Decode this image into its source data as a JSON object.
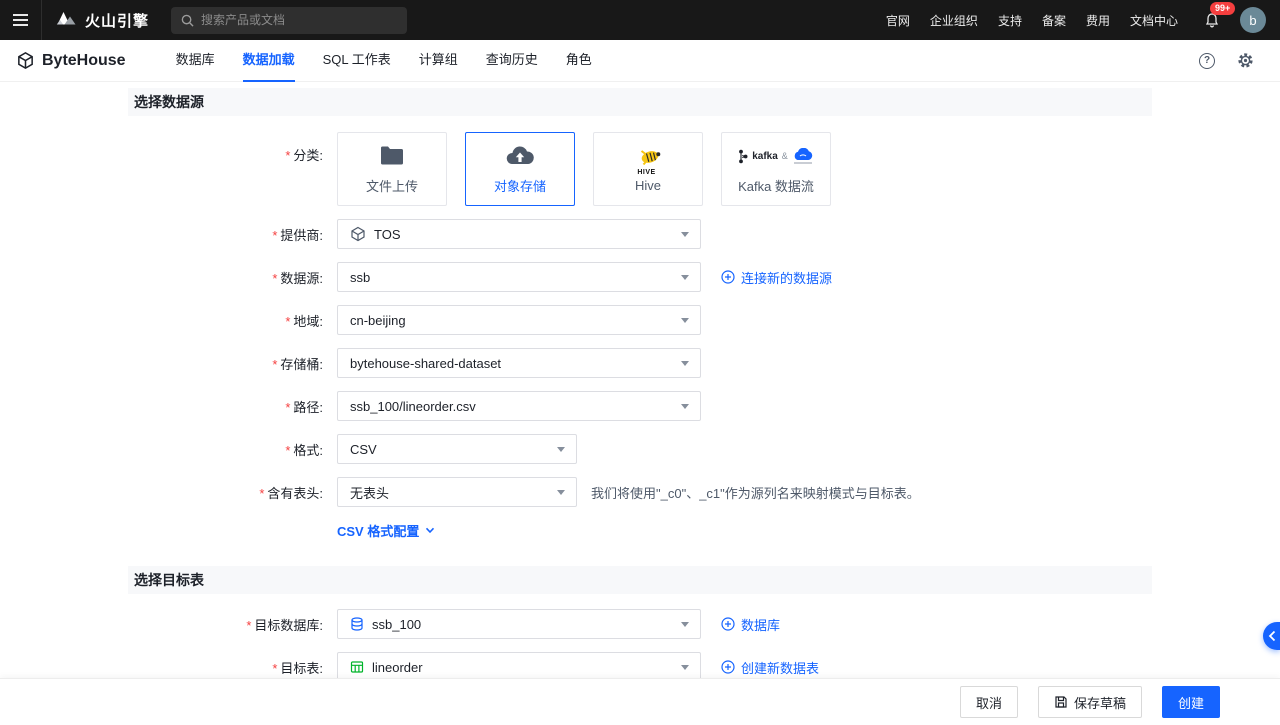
{
  "ui": {
    "required_marker": "*",
    "help_glyph": "?"
  },
  "topbar": {
    "brand": "火山引擎",
    "search": {
      "placeholder": "搜索产品或文档"
    },
    "links": [
      {
        "label": "官网"
      },
      {
        "label": "企业组织"
      },
      {
        "label": "支持"
      },
      {
        "label": "备案"
      },
      {
        "label": "费用"
      },
      {
        "label": "文档中心"
      }
    ],
    "notification_badge": "99+",
    "avatar": "b"
  },
  "appbar": {
    "brand": "ByteHouse",
    "tabs": [
      {
        "label": "数据库"
      },
      {
        "label": "数据加载"
      },
      {
        "label": "SQL 工作表"
      },
      {
        "label": "计算组"
      },
      {
        "label": "查询历史"
      },
      {
        "label": "角色"
      }
    ],
    "active_tab": "数据加载"
  },
  "source_section": {
    "title": "选择数据源",
    "category": {
      "label": "分类:",
      "cards": [
        {
          "label": "文件上传"
        },
        {
          "label": "对象存储",
          "selected": true
        },
        {
          "label": "Hive"
        },
        {
          "label": "Kafka 数据流"
        }
      ]
    },
    "provider": {
      "label": "提供商:",
      "value": "TOS"
    },
    "datasource": {
      "label": "数据源:",
      "value": "ssb",
      "action": "连接新的数据源"
    },
    "region": {
      "label": "地域:",
      "value": "cn-beijing"
    },
    "bucket": {
      "label": "存储桶:",
      "value": "bytehouse-shared-dataset"
    },
    "path": {
      "label": "路径:",
      "value": "ssb_100/lineorder.csv"
    },
    "format": {
      "label": "格式:",
      "value": "CSV"
    },
    "header_option": {
      "label": "含有表头:",
      "value": "无表头",
      "hint": "我们将使用\"_c0\"、_c1\"作为源列名来映射模式与目标表。"
    },
    "csv_config_link": "CSV 格式配置"
  },
  "target_section": {
    "title": "选择目标表",
    "database": {
      "label": "目标数据库:",
      "value": "ssb_100",
      "action": "数据库"
    },
    "table": {
      "label": "目标表:",
      "value": "lineorder",
      "action": "创建新数据表"
    }
  },
  "hive_icon_text": "HIVE",
  "kafka_icon": {
    "wordmark": "kafka",
    "amp": "&"
  },
  "footer": {
    "cancel": "取消",
    "save_draft": "保存草稿",
    "create": "创建"
  },
  "colors": {
    "accent": "#1664ff",
    "badge": "#f53f3f",
    "topbar_bg": "#181818"
  }
}
